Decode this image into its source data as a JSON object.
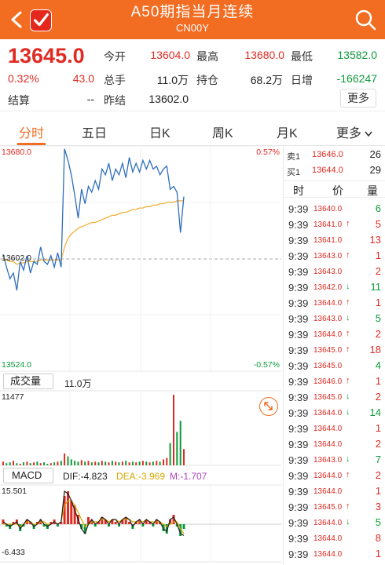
{
  "header": {
    "title": "A50期指当月连续",
    "subtitle": "CN00Y"
  },
  "quote": {
    "price": "13645.0",
    "change_pct": "0.32%",
    "change": "43.0",
    "open_label": "今开",
    "open": "13604.0",
    "high_label": "最高",
    "high": "13680.0",
    "low_label": "最低",
    "low": "13582.0",
    "volume_label": "总手",
    "volume": "11.0万",
    "oi_label": "持仓",
    "oi": "68.2万",
    "oi_inc_label": "日增",
    "oi_inc": "-166247",
    "settle_label": "结算",
    "settle": "--",
    "prev_settle_label": "昨结",
    "prev_settle": "13602.0",
    "more_label": "更多"
  },
  "tabs": [
    {
      "label": "分时",
      "active": true
    },
    {
      "label": "五日"
    },
    {
      "label": "日K"
    },
    {
      "label": "周K"
    },
    {
      "label": "月K"
    },
    {
      "label": "更多"
    }
  ],
  "chart": {
    "price_max": "13680.0",
    "price_mid": "13602.0",
    "price_min": "13524.0",
    "pct_max": "0.57%",
    "pct_min": "-0.57%",
    "volume_label": "成交量",
    "volume_value": "11.0万",
    "volume_max": "11477",
    "macd_label": "MACD",
    "dif_text": "DIF:-4.823",
    "dea_text": "DEA:-3.969",
    "m_text": "M:-1.707",
    "macd_max": "15.501",
    "macd_min": "-6.433"
  },
  "chart_data": {
    "type": "line",
    "yrange": [
      13524.0,
      13680.0
    ],
    "reference": 13602.0,
    "series": [
      {
        "values": [
          13605,
          13596,
          13588,
          13592,
          13580,
          13600,
          13594,
          13604,
          13592,
          13600,
          13598,
          13610,
          13600,
          13598,
          13604,
          13596,
          13606,
          13596,
          13678,
          13670,
          13660,
          13646,
          13630,
          13650,
          13640,
          13652,
          13648,
          13656,
          13650,
          13664,
          13660,
          13668,
          13656,
          13664,
          13660,
          13668,
          13658,
          13672,
          13662,
          13668,
          13662,
          13670,
          13664,
          13670,
          13664,
          13666,
          13660,
          13664,
          13666,
          13650,
          13652,
          13648,
          13620,
          13645
        ]
      },
      {
        "values": [
          13602,
          13601,
          13600,
          13600,
          13598,
          13599,
          13599,
          13600,
          13600,
          13600,
          13600,
          13601,
          13601,
          13601,
          13601,
          13601,
          13601,
          13601,
          13610,
          13616,
          13619,
          13621,
          13623,
          13624,
          13625,
          13626,
          13627,
          13627,
          13628,
          13629,
          13630,
          13631,
          13632,
          13632,
          13633,
          13634,
          13634,
          13635,
          13636,
          13636,
          13637,
          13637,
          13638,
          13638,
          13639,
          13639,
          13640,
          13640,
          13641,
          13641,
          13641,
          13642,
          13642,
          13642
        ]
      }
    ],
    "volume": [
      5,
      3,
      4,
      6,
      3,
      2,
      4,
      5,
      3,
      4,
      5,
      3,
      4,
      2,
      3,
      4,
      5,
      6,
      16,
      12,
      8,
      6,
      5,
      7,
      5,
      6,
      4,
      5,
      4,
      6,
      5,
      4,
      6,
      5,
      4,
      5,
      6,
      4,
      5,
      4,
      5,
      6,
      5,
      4,
      5,
      6,
      5,
      8,
      10,
      30,
      95,
      45,
      60,
      22
    ],
    "macd_hist": [
      2,
      -1,
      -2,
      1,
      2,
      -3,
      -1,
      2,
      1,
      -2,
      1,
      2,
      -1,
      -2,
      1,
      2,
      -1,
      1,
      12,
      14,
      10,
      8,
      4,
      -2,
      -4,
      3,
      2,
      -1,
      1,
      3,
      2,
      -1,
      2,
      1,
      -1,
      2,
      3,
      1,
      -2,
      1,
      2,
      -1,
      2,
      1,
      -1,
      2,
      1,
      -3,
      -4,
      2,
      4,
      -1,
      -5,
      -2
    ],
    "macd_dif": [
      1,
      0,
      -1,
      0,
      1,
      -2,
      0,
      2,
      1,
      -1,
      0,
      2,
      0,
      -1,
      0,
      1,
      0,
      1,
      14,
      13,
      10,
      6,
      2,
      -2,
      -4,
      0,
      2,
      0,
      1,
      3,
      2,
      0,
      2,
      2,
      0,
      2,
      3,
      2,
      -1,
      1,
      2,
      0,
      2,
      1,
      0,
      2,
      1,
      -2,
      -3,
      2,
      3,
      0,
      -4,
      -4.8
    ],
    "macd_dea": [
      0,
      0,
      0,
      0,
      0,
      -1,
      0,
      1,
      1,
      0,
      0,
      1,
      1,
      0,
      0,
      1,
      0,
      1,
      8,
      10,
      10,
      8,
      5,
      2,
      -1,
      0,
      1,
      1,
      1,
      2,
      2,
      1,
      2,
      2,
      1,
      2,
      2,
      2,
      1,
      1,
      1,
      1,
      2,
      1,
      1,
      1,
      1,
      0,
      -1,
      0,
      1,
      1,
      -2,
      -3.97
    ]
  },
  "order_book": {
    "sell1_label": "卖1",
    "sell1_price": "13646.0",
    "sell1_vol": "26",
    "buy1_label": "买1",
    "buy1_price": "13644.0",
    "buy1_vol": "29"
  },
  "ticks_header": {
    "time": "时",
    "price": "价",
    "vol": "量"
  },
  "ticks": [
    {
      "time": "9:39",
      "price": "13640.0",
      "dir": "",
      "vol": "6",
      "color": "#0d9b3a"
    },
    {
      "time": "9:39",
      "price": "13641.0",
      "dir": "↑",
      "vol": "5",
      "color": "#e02b23"
    },
    {
      "time": "9:39",
      "price": "13641.0",
      "dir": "",
      "vol": "13",
      "color": "#e02b23"
    },
    {
      "time": "9:39",
      "price": "13643.0",
      "dir": "↑",
      "vol": "1",
      "color": "#e02b23"
    },
    {
      "time": "9:39",
      "price": "13643.0",
      "dir": "",
      "vol": "2",
      "color": "#e02b23"
    },
    {
      "time": "9:39",
      "price": "13642.0",
      "dir": "↓",
      "vol": "11",
      "color": "#0d9b3a"
    },
    {
      "time": "9:39",
      "price": "13644.0",
      "dir": "↑",
      "vol": "1",
      "color": "#e02b23"
    },
    {
      "time": "9:39",
      "price": "13643.0",
      "dir": "↓",
      "vol": "5",
      "color": "#0d9b3a"
    },
    {
      "time": "9:39",
      "price": "13644.0",
      "dir": "↑",
      "vol": "2",
      "color": "#e02b23"
    },
    {
      "time": "9:39",
      "price": "13645.0",
      "dir": "↑",
      "vol": "18",
      "color": "#e02b23"
    },
    {
      "time": "9:39",
      "price": "13645.0",
      "dir": "",
      "vol": "4",
      "color": "#0d9b3a"
    },
    {
      "time": "9:39",
      "price": "13646.0",
      "dir": "↑",
      "vol": "1",
      "color": "#e02b23"
    },
    {
      "time": "9:39",
      "price": "13645.0",
      "dir": "↓",
      "vol": "2",
      "color": "#e02b23"
    },
    {
      "time": "9:39",
      "price": "13644.0",
      "dir": "↓",
      "vol": "14",
      "color": "#0d9b3a"
    },
    {
      "time": "9:39",
      "price": "13644.0",
      "dir": "",
      "vol": "1",
      "color": "#e02b23"
    },
    {
      "time": "9:39",
      "price": "13644.0",
      "dir": "",
      "vol": "2",
      "color": "#e02b23"
    },
    {
      "time": "9:39",
      "price": "13643.0",
      "dir": "↓",
      "vol": "7",
      "color": "#0d9b3a"
    },
    {
      "time": "9:39",
      "price": "13644.0",
      "dir": "↑",
      "vol": "2",
      "color": "#e02b23"
    },
    {
      "time": "9:39",
      "price": "13644.0",
      "dir": "",
      "vol": "1",
      "color": "#e02b23"
    },
    {
      "time": "9:39",
      "price": "13645.0",
      "dir": "↑",
      "vol": "3",
      "color": "#e02b23"
    },
    {
      "time": "9:39",
      "price": "13644.0",
      "dir": "↓",
      "vol": "5",
      "color": "#0d9b3a"
    },
    {
      "time": "9:39",
      "price": "13644.0",
      "dir": "",
      "vol": "8",
      "color": "#e02b23"
    },
    {
      "time": "9:39",
      "price": "13644.0",
      "dir": "",
      "vol": "1",
      "color": "#e02b23"
    }
  ],
  "colors": {
    "accent": "#f26c21",
    "up": "#e02b23",
    "down": "#0d9b3a",
    "price_line": "#2e6dbd",
    "avg_line": "#f0b13c"
  }
}
